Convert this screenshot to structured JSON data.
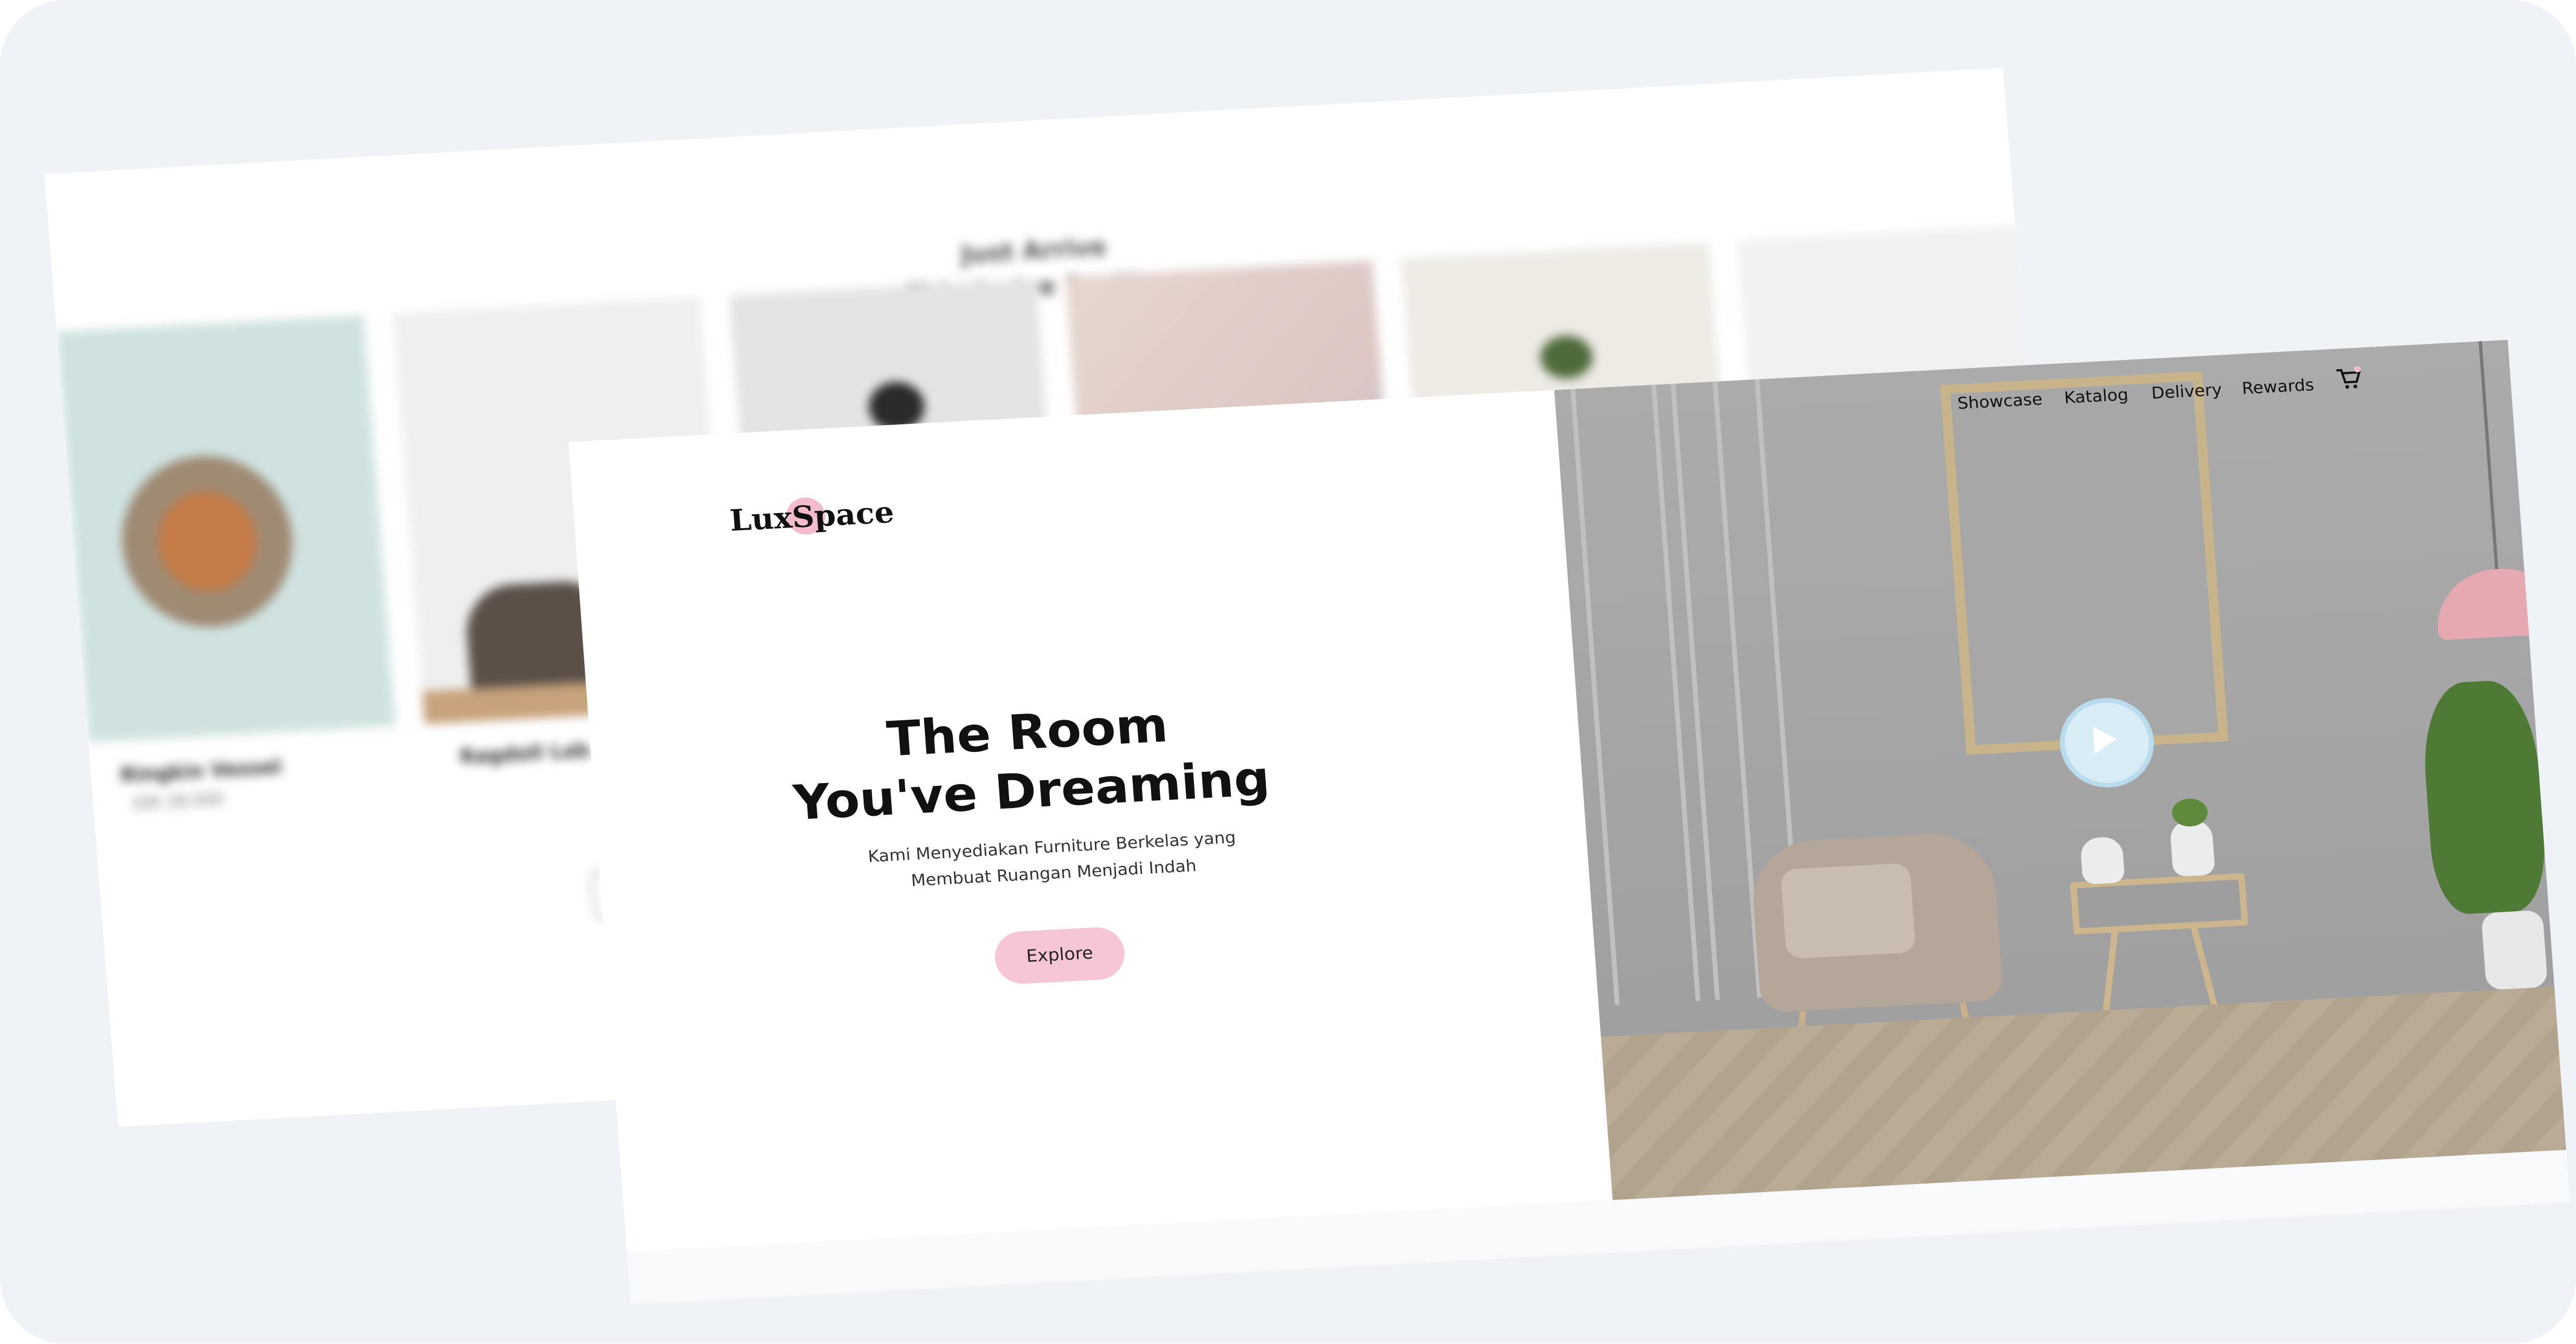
{
  "back_page": {
    "heading_line1": "Just Arrive",
    "heading_line2": "This Arrive For You",
    "products": [
      {
        "name": "Ringkin Vessel",
        "price": "IDR 28.000"
      },
      {
        "name": "Ragdoll Lab",
        "price": ""
      },
      {
        "name": "",
        "price": ""
      },
      {
        "name": "",
        "price": ""
      },
      {
        "name": "",
        "price": ""
      },
      {
        "name": "",
        "price": ""
      }
    ]
  },
  "front_page": {
    "logo": "LuxSpace",
    "nav": {
      "items": [
        {
          "label": "Showcase"
        },
        {
          "label": "Katalog"
        },
        {
          "label": "Delivery"
        },
        {
          "label": "Rewards"
        }
      ],
      "cart_icon": "cart-icon"
    },
    "hero": {
      "title_line1": "The Room",
      "title_line2": "You've Dreaming",
      "subtitle_line1": "Kami Menyediakan Furniture Berkelas yang",
      "subtitle_line2": "Membuat Ruangan Menjadi Indah",
      "cta_label": "Explore",
      "play_icon": "play-icon"
    }
  },
  "colors": {
    "background": "#eff3f8",
    "accent_pink": "#f6c6d6",
    "play_button": "#d7ecf5"
  }
}
